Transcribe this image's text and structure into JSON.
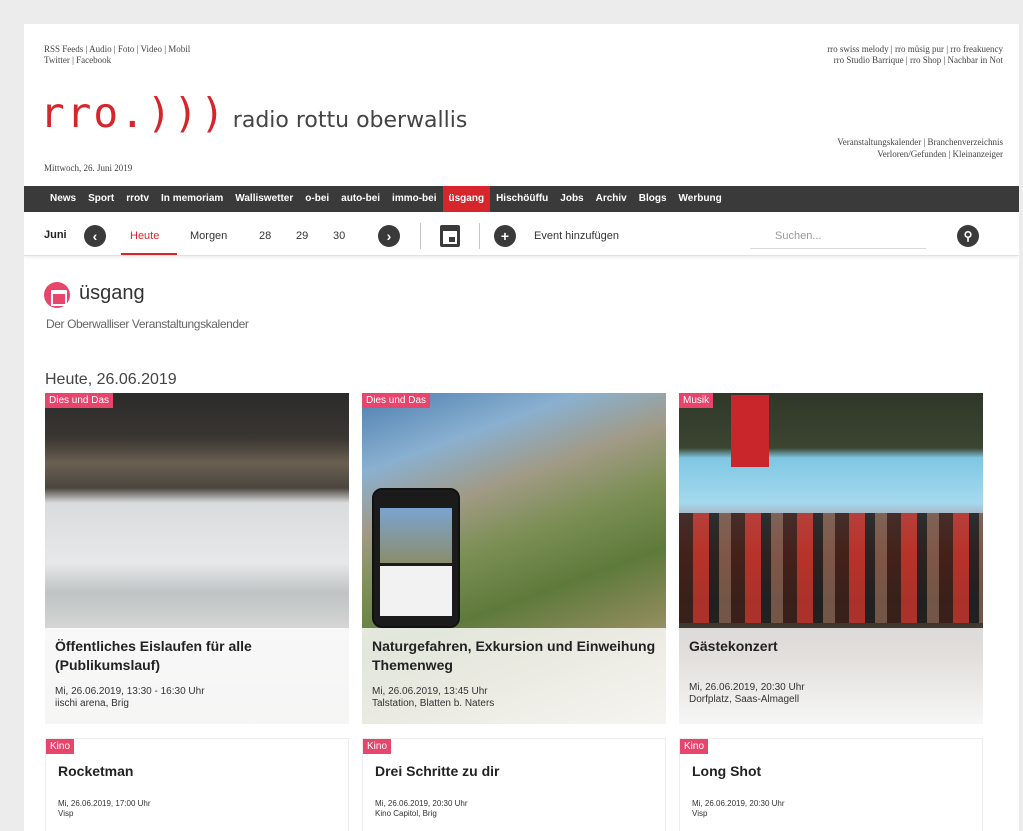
{
  "header": {
    "toplinks_left_1": "RSS Feeds | Audio | Foto | Video | Mobil",
    "toplinks_left_2": "Twitter | Facebook",
    "toplinks_right_1": "rro swiss melody | rro müsig pur | rro freakuency",
    "toplinks_right_2": "rro Studio Barrique | rro Shop | Nachbar in Not",
    "logo_mark": "rro.)))",
    "logo_text": "radio rottu oberwallis",
    "date": "Mittwoch, 26. Juni 2019",
    "sublinks_1": "Veranstaltungskalender | Branchenverzeichnis",
    "sublinks_2": "Verloren/Gefunden | Kleinanzeiger"
  },
  "nav": {
    "items": [
      "News",
      "Sport",
      "rrotv",
      "In memoriam",
      "Walliswetter",
      "o-bei",
      "auto-bei",
      "immo-bei",
      "üsgang",
      "Hischöüffu",
      "Jobs",
      "Archiv",
      "Blogs",
      "Werbung"
    ],
    "active_index": 8
  },
  "datebar": {
    "month": "Juni",
    "prev_icon": "‹",
    "next_icon": "›",
    "today": "Heute",
    "tomorrow": "Morgen",
    "d28": "28",
    "d29": "29",
    "d30": "30",
    "add_icon": "+",
    "add_event": "Event hinzufügen",
    "search_placeholder": "Suchen..."
  },
  "section": {
    "title": "üsgang",
    "subtitle": "Der Oberwalliser Veranstaltungskalender",
    "day_heading": "Heute, 26.06.2019"
  },
  "events": [
    {
      "tag": "Dies und Das",
      "title": "Öffentliches Eislaufen für alle (Publikumslauf)",
      "date": "Mi, 26.06.2019, 13:30 - 16:30 Uhr",
      "location": "iischi arena, Brig"
    },
    {
      "tag": "Dies und Das",
      "title": "Naturgefahren, Exkursion und Einweihung Themenweg",
      "date": "Mi, 26.06.2019, 13:45 Uhr",
      "location": "Talstation, Blatten b. Naters"
    },
    {
      "tag": "Musik",
      "title": "Gästekonzert",
      "date": "Mi, 26.06.2019, 20:30 Uhr",
      "location": "Dorfplatz, Saas-Almagell"
    }
  ],
  "kino": [
    {
      "tag": "Kino",
      "title": "Rocketman",
      "date": "Mi, 26.06.2019, 17:00 Uhr",
      "location": "Visp"
    },
    {
      "tag": "Kino",
      "title": "Drei Schritte zu dir",
      "date": "Mi, 26.06.2019, 20:30 Uhr",
      "location": "Kino Capitol, Brig"
    },
    {
      "tag": "Kino",
      "title": "Long Shot",
      "date": "Mi, 26.06.2019, 20:30 Uhr",
      "location": "Visp"
    }
  ],
  "colors": {
    "brand_red": "#d6262c",
    "tag_pink": "#e8456c",
    "nav_dark": "#3a3a3a"
  },
  "icons": {
    "calendar": "calendar-icon",
    "search": "search-icon",
    "add": "plus-icon"
  }
}
